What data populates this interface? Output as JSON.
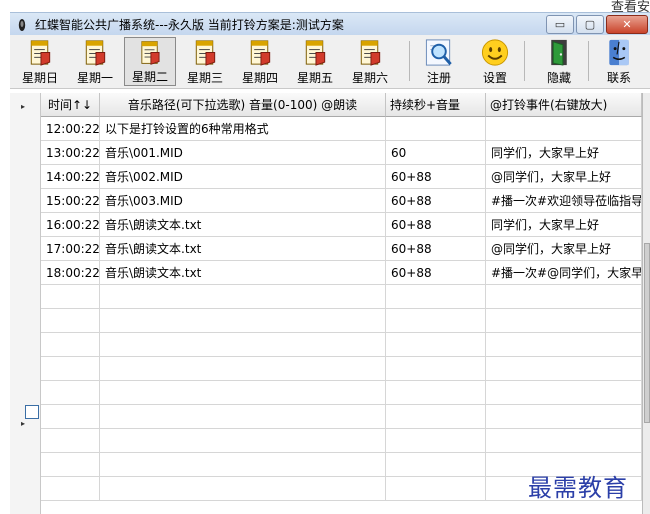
{
  "corner_text": "查看安",
  "window": {
    "title": "红蝶智能公共广播系统---永久版  当前打铃方案是:测试方案",
    "minimize_label": "▭",
    "maximize_label": "▢",
    "close_label": "✕"
  },
  "toolbar": {
    "days": [
      {
        "label": "星期日",
        "icon": "schedule-day-icon"
      },
      {
        "label": "星期一",
        "icon": "schedule-day-icon"
      },
      {
        "label": "星期二",
        "icon": "schedule-day-icon",
        "active": true
      },
      {
        "label": "星期三",
        "icon": "schedule-day-icon"
      },
      {
        "label": "星期四",
        "icon": "schedule-day-icon"
      },
      {
        "label": "星期五",
        "icon": "schedule-day-icon"
      },
      {
        "label": "星期六",
        "icon": "schedule-day-icon"
      }
    ],
    "register_label": "注册",
    "settings_label": "设置",
    "hide_label": "隐藏",
    "contact_label": "联系"
  },
  "table": {
    "headers": [
      "时间↑↓",
      "音乐路径(可下拉选歌) 音量(0-100) @朗读",
      "持续秒+音量",
      "@打铃事件(右键放大)"
    ],
    "rows": [
      [
        "12:00:22",
        "以下是打铃设置的6种常用格式",
        "",
        ""
      ],
      [
        "13:00:22",
        "音乐\\001.MID",
        "60",
        "同学们，大家早上好"
      ],
      [
        "14:00:22",
        "音乐\\002.MID",
        "60+88",
        "@同学们，大家早上好"
      ],
      [
        "15:00:22",
        "音乐\\003.MID",
        "60+88",
        "#播一次#欢迎领导莅临指导"
      ],
      [
        "16:00:22",
        "音乐\\朗读文本.txt",
        "60+88",
        "同学们，大家早上好"
      ],
      [
        "17:00:22",
        "音乐\\朗读文本.txt",
        "60+88",
        "@同学们，大家早上好"
      ],
      [
        "18:00:22",
        "音乐\\朗读文本.txt",
        "60+88",
        "#播一次#@同学们，大家早"
      ]
    ],
    "empty_rows": 9
  },
  "watermark": "最需教育",
  "colors": {
    "titlebar": "#c3d6ee",
    "toolbar": "#f0f0f0",
    "grid_line": "#d6d6d6",
    "watermark": "#2b3fa8"
  }
}
